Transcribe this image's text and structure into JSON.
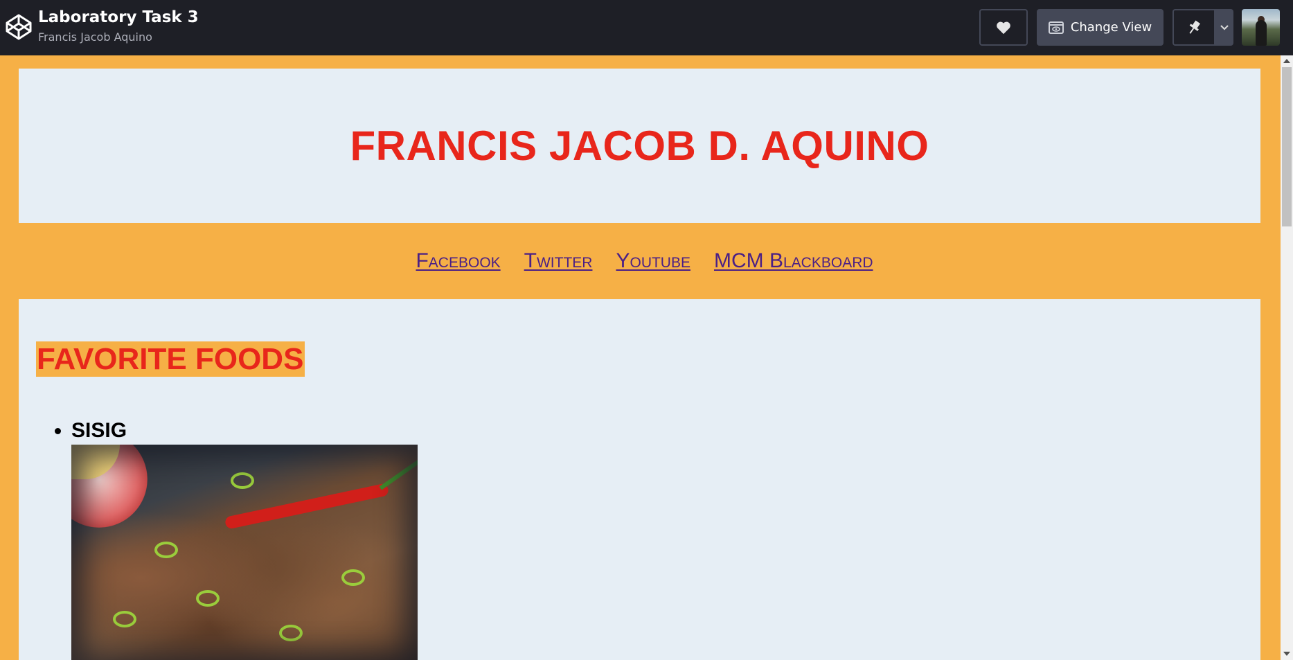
{
  "app": {
    "title": "Laboratory Task 3",
    "author": "Francis Jacob Aquino"
  },
  "toolbar": {
    "heart_icon": "heart-icon",
    "change_view_label": "Change View",
    "pin_icon": "pin-icon",
    "dropdown_icon": "chevron-down-icon"
  },
  "page": {
    "heading": "FRANCIS JACOB D. AQUINO",
    "nav": [
      {
        "label": "Facebook"
      },
      {
        "label": "Twitter"
      },
      {
        "label": "Youtube"
      },
      {
        "label": "MCM Blackboard"
      }
    ],
    "section_title": "FAVORITE FOODS",
    "foods": [
      {
        "name": "SISIG"
      }
    ]
  },
  "colors": {
    "topbar": "#1e1f26",
    "preview_bg": "#f6b046",
    "box_bg": "#e6eef5",
    "heading": "#e8261b",
    "link": "#4a1f86"
  }
}
